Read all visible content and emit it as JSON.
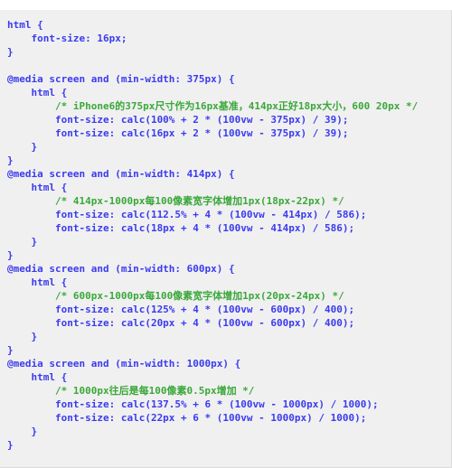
{
  "document": {
    "kind": "css-code-snippet",
    "language": "CSS",
    "colors": {
      "background": "#f0f0f0",
      "code": "#3b3bf0",
      "comment": "#3aa83a",
      "border": "#dcdcdc",
      "page": "#ffffff"
    }
  },
  "code": {
    "lines": [
      {
        "indent": 0,
        "type": "code",
        "text": "html {"
      },
      {
        "indent": 1,
        "type": "code",
        "text": "font-size: 16px;"
      },
      {
        "indent": 0,
        "type": "code",
        "text": "}"
      },
      {
        "indent": 0,
        "type": "blank",
        "text": ""
      },
      {
        "indent": 0,
        "type": "code",
        "text": "@media screen and (min-width: 375px) {"
      },
      {
        "indent": 1,
        "type": "code",
        "text": "html {"
      },
      {
        "indent": 2,
        "type": "comment",
        "text": "/* iPhone6的375px尺寸作为16px基准，414px正好18px大小，600 20px */"
      },
      {
        "indent": 2,
        "type": "code",
        "text": "font-size: calc(100% + 2 * (100vw - 375px) / 39);"
      },
      {
        "indent": 2,
        "type": "code",
        "text": "font-size: calc(16px + 2 * (100vw - 375px) / 39);"
      },
      {
        "indent": 1,
        "type": "code",
        "text": "}"
      },
      {
        "indent": 0,
        "type": "code",
        "text": "}"
      },
      {
        "indent": 0,
        "type": "code",
        "text": "@media screen and (min-width: 414px) {"
      },
      {
        "indent": 1,
        "type": "code",
        "text": "html {"
      },
      {
        "indent": 2,
        "type": "comment",
        "text": "/* 414px-1000px每100像素宽字体增加1px(18px-22px) */"
      },
      {
        "indent": 2,
        "type": "code",
        "text": "font-size: calc(112.5% + 4 * (100vw - 414px) / 586);"
      },
      {
        "indent": 2,
        "type": "code",
        "text": "font-size: calc(18px + 4 * (100vw - 414px) / 586);"
      },
      {
        "indent": 1,
        "type": "code",
        "text": "}"
      },
      {
        "indent": 0,
        "type": "code",
        "text": "}"
      },
      {
        "indent": 0,
        "type": "code",
        "text": "@media screen and (min-width: 600px) {"
      },
      {
        "indent": 1,
        "type": "code",
        "text": "html {"
      },
      {
        "indent": 2,
        "type": "comment",
        "text": "/* 600px-1000px每100像素宽字体增加1px(20px-24px) */"
      },
      {
        "indent": 2,
        "type": "code",
        "text": "font-size: calc(125% + 4 * (100vw - 600px) / 400);"
      },
      {
        "indent": 2,
        "type": "code",
        "text": "font-size: calc(20px + 4 * (100vw - 600px) / 400);"
      },
      {
        "indent": 1,
        "type": "code",
        "text": "}"
      },
      {
        "indent": 0,
        "type": "code",
        "text": "}"
      },
      {
        "indent": 0,
        "type": "code",
        "text": "@media screen and (min-width: 1000px) {"
      },
      {
        "indent": 1,
        "type": "code",
        "text": "html {"
      },
      {
        "indent": 2,
        "type": "comment",
        "text": "/* 1000px往后是每100像素0.5px增加 */"
      },
      {
        "indent": 2,
        "type": "code",
        "text": "font-size: calc(137.5% + 6 * (100vw - 1000px) / 1000);"
      },
      {
        "indent": 2,
        "type": "code",
        "text": "font-size: calc(22px + 6 * (100vw - 1000px) / 1000);"
      },
      {
        "indent": 1,
        "type": "code",
        "text": "}"
      },
      {
        "indent": 0,
        "type": "code",
        "text": "}"
      }
    ]
  }
}
